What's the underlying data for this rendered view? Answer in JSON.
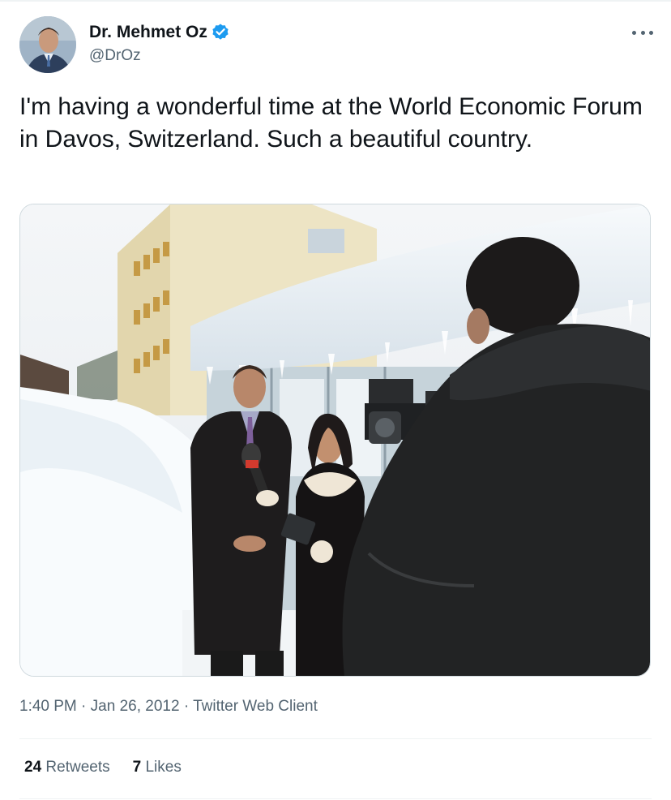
{
  "author": {
    "display_name": "Dr. Mehmet Oz",
    "handle": "@DrOz",
    "verified": true,
    "verified_badge_color": "#1d9bf0"
  },
  "tweet": {
    "text": "I'm having a wonderful time at the World Economic Forum in Davos, Switzerland. Such a beautiful country.",
    "time": "1:40 PM",
    "separator": "·",
    "date": "Jan 26, 2012",
    "client": "Twitter Web Client"
  },
  "stats": {
    "retweets_count": "24",
    "retweets_label": "Retweets",
    "likes_count": "7",
    "likes_label": "Likes"
  },
  "icons": {
    "more": "more-options-icon",
    "verified": "verified-badge-icon"
  },
  "colors": {
    "text_primary": "#0f1419",
    "text_secondary": "#536471",
    "border": "#cfd9de"
  }
}
